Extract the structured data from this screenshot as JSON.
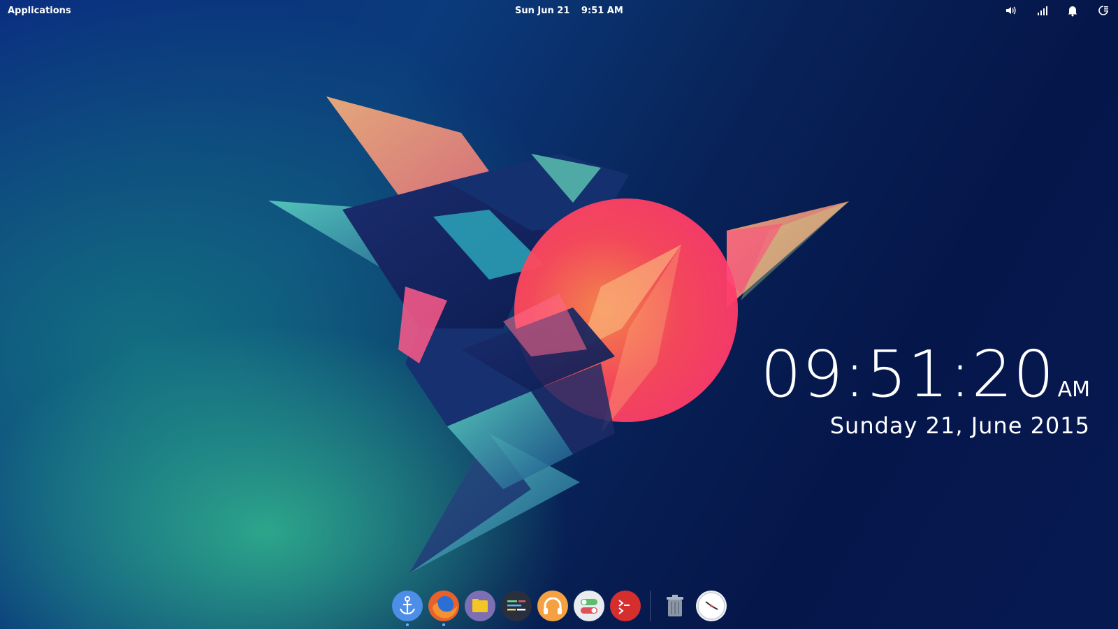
{
  "top_panel": {
    "applications_label": "Applications",
    "date": "Sun Jun 21",
    "time": "9:51 AM",
    "indicators": [
      "volume-icon",
      "network-icon",
      "notifications-icon",
      "session-icon"
    ]
  },
  "desktop_clock": {
    "time": "09:51:20",
    "ampm": "AM",
    "date": "Sunday  21, June 2015"
  },
  "dock": {
    "items": [
      {
        "name": "anchor-icon",
        "running": true
      },
      {
        "name": "firefox-icon",
        "running": true
      },
      {
        "name": "files-icon",
        "running": false
      },
      {
        "name": "code-editor-icon",
        "running": false
      },
      {
        "name": "music-icon",
        "running": false
      },
      {
        "name": "settings-toggle-icon",
        "running": false
      },
      {
        "name": "terminal-icon",
        "running": false
      },
      {
        "name": "trash-icon",
        "running": false
      },
      {
        "name": "clock-icon",
        "running": false
      }
    ]
  },
  "colors": {
    "sun": "#ff4a55",
    "accent_orange": "#ff9a4d",
    "accent_teal": "#2fb5c5",
    "background_deep": "#061a52",
    "background_green": "#2eaa8c"
  }
}
